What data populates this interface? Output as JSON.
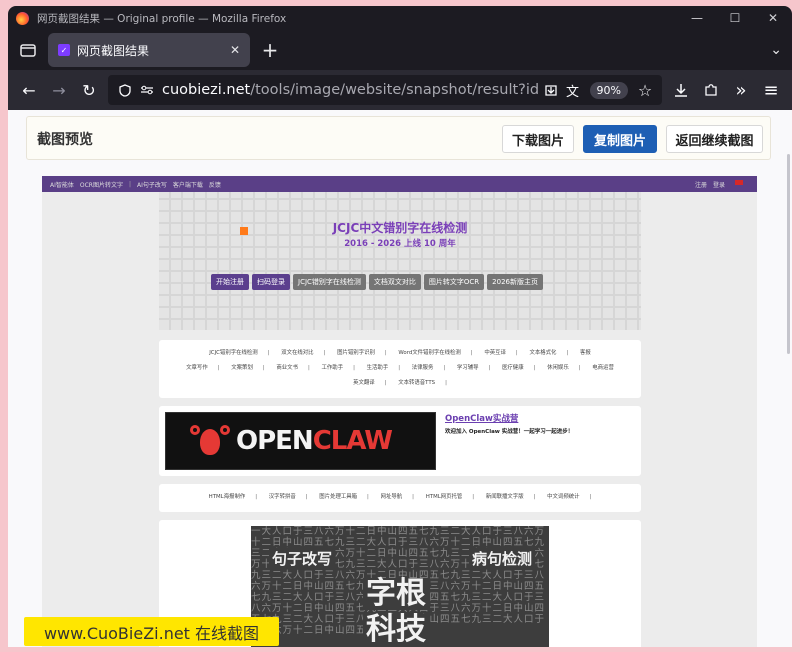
{
  "window": {
    "title": "网页截图结果 — Original profile — Mozilla Firefox",
    "controls": {
      "minimize": "—",
      "maximize": "☐",
      "close": "✕"
    }
  },
  "tabs": [
    {
      "label": "网页截图结果",
      "close": "✕"
    }
  ],
  "toolbar": {
    "new_tab": "+",
    "list_all_tabs": "⌄",
    "back": "←",
    "forward": "→",
    "reload": "↻",
    "url_host": "cuobiezi.net",
    "url_path": "/tools/image/website/snapshot/result?id=jcjc",
    "zoom": "90%",
    "menu": "≡"
  },
  "preview": {
    "title": "截图预览",
    "download_label": "下载图片",
    "copy_label": "复制图片",
    "back_label": "返回继续截图"
  },
  "site": {
    "topnav": [
      "AI智能体",
      "OCR图片转文字",
      "|",
      "AI句子改写",
      "客户端下载",
      "反馈"
    ],
    "topnav_right": [
      "注册",
      "登录"
    ],
    "hero_title": "JCJC中文错别字在线检测",
    "hero_sub": "2016 - 2026 上线 10 周年",
    "hero_buttons": [
      "开始注册",
      "扫码登录",
      "JCJC错别字在线检测",
      "文档双文对比",
      "图片转文字OCR",
      "2026新版主页"
    ],
    "link_rows": [
      [
        "JCJC错别字在线检测",
        "双文在线对比",
        "图片错别字识别",
        "Word文件错别字在线检测",
        "中英互译",
        "文本格式化",
        "客报"
      ],
      [
        "文章写作",
        "文案策划",
        "商业文书",
        "工作助手",
        "生活助手",
        "法律服务",
        "学习辅导",
        "医疗健康",
        "休闲娱乐",
        "电商运营"
      ],
      [
        "英文翻译",
        "文本转语音TTS"
      ]
    ],
    "promo_word_1": "OPEN",
    "promo_word_2": "CLAW",
    "promo_title": "OpenClaw实战营",
    "promo_desc": "欢迎加入 OpenClaw 实战营！一起学习一起进步！",
    "tools_row": [
      "HTML海报制作",
      "汉字转拼音",
      "图片处理工具箱",
      "网址导航",
      "HTML网页托管",
      "新闻联播文字版",
      "中文词频统计"
    ],
    "poster_labels": [
      "句子改写",
      "病句检测",
      "字根",
      "科技"
    ],
    "poster_bg": "一大人口于三八六万十二日中山四五七九三二大人口于三八六万十二日中山四五七九三二大人口于三八六万十二日中山四五七九三二大人口于三八六万十二日中山四五七九三二大人口于三八六万十二日中山四五七九三二大人口于三八六万十二日中山四五七九三二大人口于三八六万十二日中山四五七九三二大人口于三八六万十二日中山四五七九三二大人口于三八六万十二日中山四五七九三二大人口于三八六万十二日中山四五七九三二大人口于三八六万十二日中山四五七九三二大人口于三八六万十二日中山四五七九三二大人口于三八六万十二日中山四五七九三二大人口于三八六万十二日中山四五七九三二"
  },
  "watermark": "www.CuoBieZi.net 在线截图"
}
